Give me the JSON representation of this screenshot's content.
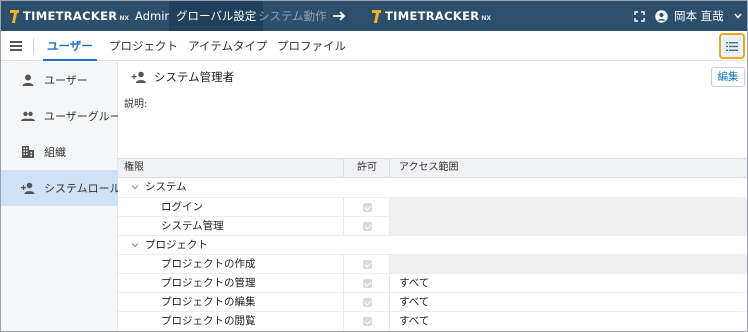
{
  "header": {
    "logo_text": "TIMETRACKER",
    "logo_suffix": "NX",
    "admin_label": "Admin",
    "tabs": [
      {
        "label": "グローバル設定",
        "active": true
      },
      {
        "label": "システム動作",
        "active": false
      }
    ],
    "user_name": "岡本 直哉",
    "icons": {
      "arrow": "arrow-right-icon",
      "expand": "fullscreen-icon",
      "user": "account-circle-icon",
      "chevron": "chevron-down-icon"
    }
  },
  "nav": {
    "tabs": [
      {
        "label": "ユーザー",
        "active": true
      },
      {
        "label": "プロジェクト",
        "active": false
      },
      {
        "label": "アイテムタイプ",
        "active": false
      },
      {
        "label": "プロファイル",
        "active": false
      }
    ]
  },
  "sidebar": {
    "items": [
      {
        "label": "ユーザー",
        "icon": "person-icon",
        "active": false
      },
      {
        "label": "ユーザーグループ",
        "icon": "group-icon",
        "active": false
      },
      {
        "label": "組織",
        "icon": "building-icon",
        "active": false
      },
      {
        "label": "システムロール",
        "icon": "person-add-icon",
        "active": true
      }
    ]
  },
  "main": {
    "role_title": "システム管理者",
    "edit_label": "編集",
    "description_label": "説明:",
    "table": {
      "headers": {
        "name": "権限",
        "permission": "許可",
        "scope": "アクセス範囲"
      },
      "groups": [
        {
          "label": "システム",
          "rows": [
            {
              "label": "ログイン",
              "checked": true,
              "scope": ""
            },
            {
              "label": "システム管理",
              "checked": true,
              "scope": ""
            }
          ]
        },
        {
          "label": "プロジェクト",
          "rows": [
            {
              "label": "プロジェクトの作成",
              "checked": true,
              "scope": ""
            },
            {
              "label": "プロジェクトの管理",
              "checked": true,
              "scope": "すべて"
            },
            {
              "label": "プロジェクトの編集",
              "checked": true,
              "scope": "すべて"
            },
            {
              "label": "プロジェクトの閲覧",
              "checked": true,
              "scope": "すべて"
            }
          ]
        }
      ]
    }
  },
  "colors": {
    "header_bg": "#2c4f6e",
    "accent": "#1a73c7",
    "logo": "#f1b21b",
    "highlight": "#f0a81e"
  }
}
